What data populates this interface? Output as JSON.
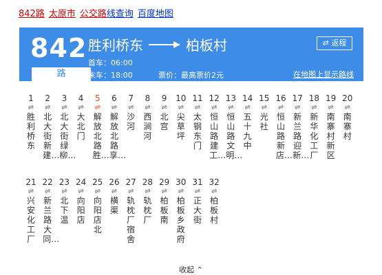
{
  "breadcrumb": {
    "route": "842路",
    "city": "太原市",
    "category": "公交路",
    "query": "线查询",
    "map": "百度地图"
  },
  "route": {
    "number": "842",
    "suffix": "路",
    "from": "胜利桥东",
    "to": "柏板村",
    "first_bus": "首车：06:00",
    "last_bus": "末车：18:00",
    "fare": "票价：最高票价2元",
    "reverse_label": "⇄ 返程",
    "map_link": "在地图上显示路线"
  },
  "stops": [
    {
      "idx": "1",
      "name": "胜利桥东"
    },
    {
      "idx": "2",
      "name": "北大街新建…"
    },
    {
      "idx": "3",
      "name": "北大街绿柳…"
    },
    {
      "idx": "4",
      "name": "大北门"
    },
    {
      "idx": "5",
      "name": "解放北路胜…"
    },
    {
      "idx": "6",
      "name": "解放北路享…"
    },
    {
      "idx": "7",
      "name": "沙河"
    },
    {
      "idx": "8",
      "name": "西涧河"
    },
    {
      "idx": "9",
      "name": "北宫"
    },
    {
      "idx": "10",
      "name": "尖草坪"
    },
    {
      "idx": "11",
      "name": "太钢东门"
    },
    {
      "idx": "12",
      "name": "恒山路建工…"
    },
    {
      "idx": "13",
      "name": "恒山路文明…"
    },
    {
      "idx": "14",
      "name": "五十九中"
    },
    {
      "idx": "15",
      "name": "光社"
    },
    {
      "idx": "16",
      "name": "恒山路新店…"
    },
    {
      "idx": "17",
      "name": "新兰路迎新…"
    },
    {
      "idx": "18",
      "name": "新华化工厂"
    },
    {
      "idx": "19",
      "name": "南寨村新区"
    },
    {
      "idx": "20",
      "name": "南寨村"
    },
    {
      "idx": "21",
      "name": "兴安化工厂"
    },
    {
      "idx": "22",
      "name": "新兰路大同…"
    },
    {
      "idx": "23",
      "name": "北下温"
    },
    {
      "idx": "24",
      "name": "向阳店"
    },
    {
      "idx": "25",
      "name": "向阳店北"
    },
    {
      "idx": "26",
      "name": "横渠"
    },
    {
      "idx": "27",
      "name": "轨枕厂宿舍"
    },
    {
      "idx": "28",
      "name": "轨枕厂"
    },
    {
      "idx": "29",
      "name": "柏板南"
    },
    {
      "idx": "30",
      "name": "柏板乡政府"
    },
    {
      "idx": "31",
      "name": "正大街"
    },
    {
      "idx": "32",
      "name": "柏板村"
    }
  ],
  "current_stop_index": "5",
  "collapse_label": "收起 ⌃",
  "colors": {
    "card_bg": "#3d8ce8",
    "accent_red": "#cc0000",
    "link_blue": "#0033cc",
    "current_stop": "#e64a19"
  },
  "icons": {
    "direction": "right-long-arrow-icon",
    "stop_arrow": "up-down-arrow-icon",
    "reverse": "swap-icon",
    "collapse": "chevron-up-icon"
  }
}
